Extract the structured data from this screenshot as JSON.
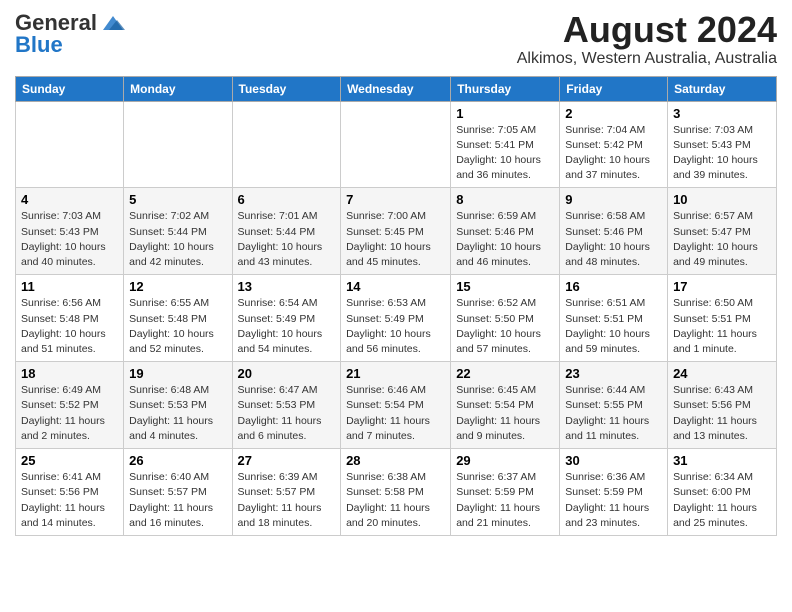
{
  "header": {
    "logo_general": "General",
    "logo_blue": "Blue",
    "month_title": "August 2024",
    "location": "Alkimos, Western Australia, Australia"
  },
  "days_of_week": [
    "Sunday",
    "Monday",
    "Tuesday",
    "Wednesday",
    "Thursday",
    "Friday",
    "Saturday"
  ],
  "weeks": [
    [
      {
        "day": "",
        "info": ""
      },
      {
        "day": "",
        "info": ""
      },
      {
        "day": "",
        "info": ""
      },
      {
        "day": "",
        "info": ""
      },
      {
        "day": "1",
        "info": "Sunrise: 7:05 AM\nSunset: 5:41 PM\nDaylight: 10 hours\nand 36 minutes."
      },
      {
        "day": "2",
        "info": "Sunrise: 7:04 AM\nSunset: 5:42 PM\nDaylight: 10 hours\nand 37 minutes."
      },
      {
        "day": "3",
        "info": "Sunrise: 7:03 AM\nSunset: 5:43 PM\nDaylight: 10 hours\nand 39 minutes."
      }
    ],
    [
      {
        "day": "4",
        "info": "Sunrise: 7:03 AM\nSunset: 5:43 PM\nDaylight: 10 hours\nand 40 minutes."
      },
      {
        "day": "5",
        "info": "Sunrise: 7:02 AM\nSunset: 5:44 PM\nDaylight: 10 hours\nand 42 minutes."
      },
      {
        "day": "6",
        "info": "Sunrise: 7:01 AM\nSunset: 5:44 PM\nDaylight: 10 hours\nand 43 minutes."
      },
      {
        "day": "7",
        "info": "Sunrise: 7:00 AM\nSunset: 5:45 PM\nDaylight: 10 hours\nand 45 minutes."
      },
      {
        "day": "8",
        "info": "Sunrise: 6:59 AM\nSunset: 5:46 PM\nDaylight: 10 hours\nand 46 minutes."
      },
      {
        "day": "9",
        "info": "Sunrise: 6:58 AM\nSunset: 5:46 PM\nDaylight: 10 hours\nand 48 minutes."
      },
      {
        "day": "10",
        "info": "Sunrise: 6:57 AM\nSunset: 5:47 PM\nDaylight: 10 hours\nand 49 minutes."
      }
    ],
    [
      {
        "day": "11",
        "info": "Sunrise: 6:56 AM\nSunset: 5:48 PM\nDaylight: 10 hours\nand 51 minutes."
      },
      {
        "day": "12",
        "info": "Sunrise: 6:55 AM\nSunset: 5:48 PM\nDaylight: 10 hours\nand 52 minutes."
      },
      {
        "day": "13",
        "info": "Sunrise: 6:54 AM\nSunset: 5:49 PM\nDaylight: 10 hours\nand 54 minutes."
      },
      {
        "day": "14",
        "info": "Sunrise: 6:53 AM\nSunset: 5:49 PM\nDaylight: 10 hours\nand 56 minutes."
      },
      {
        "day": "15",
        "info": "Sunrise: 6:52 AM\nSunset: 5:50 PM\nDaylight: 10 hours\nand 57 minutes."
      },
      {
        "day": "16",
        "info": "Sunrise: 6:51 AM\nSunset: 5:51 PM\nDaylight: 10 hours\nand 59 minutes."
      },
      {
        "day": "17",
        "info": "Sunrise: 6:50 AM\nSunset: 5:51 PM\nDaylight: 11 hours\nand 1 minute."
      }
    ],
    [
      {
        "day": "18",
        "info": "Sunrise: 6:49 AM\nSunset: 5:52 PM\nDaylight: 11 hours\nand 2 minutes."
      },
      {
        "day": "19",
        "info": "Sunrise: 6:48 AM\nSunset: 5:53 PM\nDaylight: 11 hours\nand 4 minutes."
      },
      {
        "day": "20",
        "info": "Sunrise: 6:47 AM\nSunset: 5:53 PM\nDaylight: 11 hours\nand 6 minutes."
      },
      {
        "day": "21",
        "info": "Sunrise: 6:46 AM\nSunset: 5:54 PM\nDaylight: 11 hours\nand 7 minutes."
      },
      {
        "day": "22",
        "info": "Sunrise: 6:45 AM\nSunset: 5:54 PM\nDaylight: 11 hours\nand 9 minutes."
      },
      {
        "day": "23",
        "info": "Sunrise: 6:44 AM\nSunset: 5:55 PM\nDaylight: 11 hours\nand 11 minutes."
      },
      {
        "day": "24",
        "info": "Sunrise: 6:43 AM\nSunset: 5:56 PM\nDaylight: 11 hours\nand 13 minutes."
      }
    ],
    [
      {
        "day": "25",
        "info": "Sunrise: 6:41 AM\nSunset: 5:56 PM\nDaylight: 11 hours\nand 14 minutes."
      },
      {
        "day": "26",
        "info": "Sunrise: 6:40 AM\nSunset: 5:57 PM\nDaylight: 11 hours\nand 16 minutes."
      },
      {
        "day": "27",
        "info": "Sunrise: 6:39 AM\nSunset: 5:57 PM\nDaylight: 11 hours\nand 18 minutes."
      },
      {
        "day": "28",
        "info": "Sunrise: 6:38 AM\nSunset: 5:58 PM\nDaylight: 11 hours\nand 20 minutes."
      },
      {
        "day": "29",
        "info": "Sunrise: 6:37 AM\nSunset: 5:59 PM\nDaylight: 11 hours\nand 21 minutes."
      },
      {
        "day": "30",
        "info": "Sunrise: 6:36 AM\nSunset: 5:59 PM\nDaylight: 11 hours\nand 23 minutes."
      },
      {
        "day": "31",
        "info": "Sunrise: 6:34 AM\nSunset: 6:00 PM\nDaylight: 11 hours\nand 25 minutes."
      }
    ]
  ]
}
